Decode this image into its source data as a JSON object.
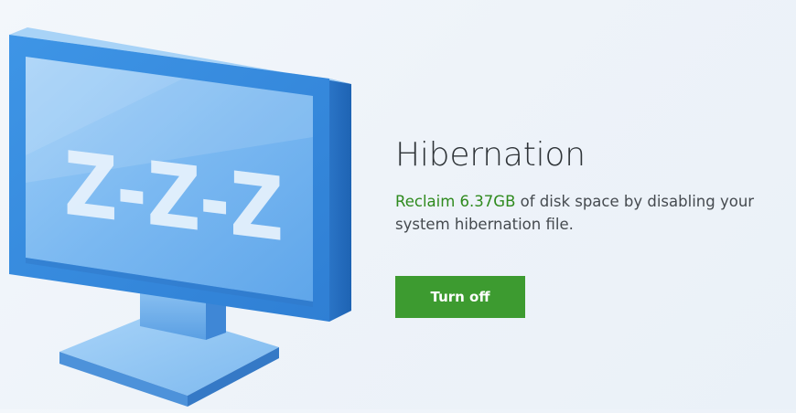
{
  "hibernation": {
    "title": "Hibernation",
    "reclaim_amount": "Reclaim 6.37GB",
    "description_rest": " of disk space by disabling your system hibernation file.",
    "action_label": "Turn off",
    "monitor_text": "Z-Z-Z"
  },
  "colors": {
    "accent_green": "#3d9b30",
    "highlight_green": "#2f8a1e",
    "monitor_blue": "#3b8fe0"
  },
  "icons": [
    "monitor-sleep-icon"
  ]
}
